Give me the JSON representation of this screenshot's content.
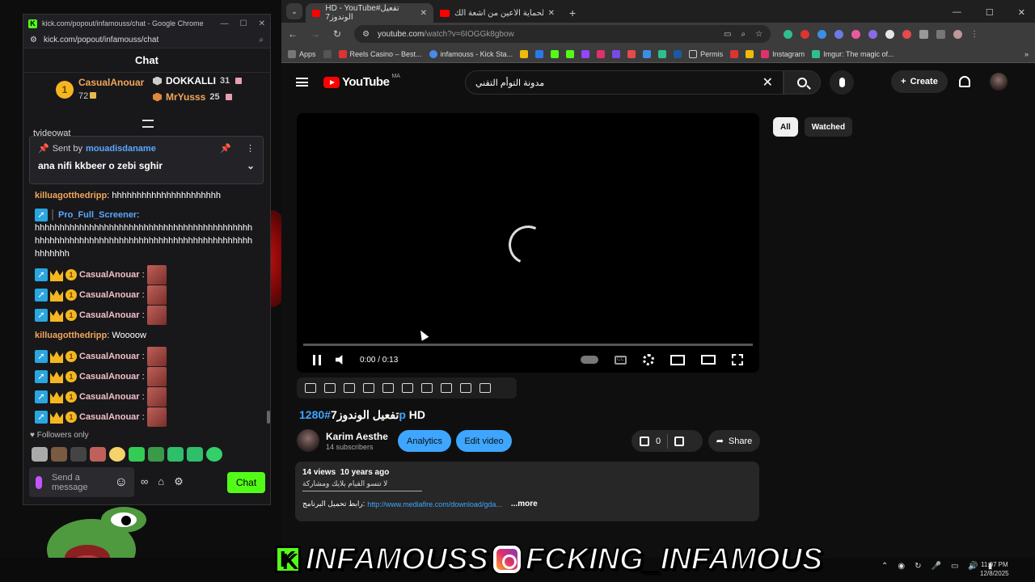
{
  "kick_window": {
    "title": "kick.com/popout/infamouss/chat - Google Chrome",
    "address": "kick.com/popout/infamouss/chat",
    "chat_title": "Chat",
    "leaderboard": [
      {
        "rank": "1",
        "name": "CasualAnouar",
        "count": "72"
      },
      {
        "rank": "",
        "name": "DOKKALLI",
        "count": "31"
      },
      {
        "rank": "3",
        "name": "MrYusss",
        "count": "25"
      }
    ],
    "cut_text": "tvideowat",
    "pinned": {
      "sent_by_label": "Sent by",
      "sender": "mouadisdaname",
      "message": "ana nifi kkbeer o zebi sghir"
    },
    "messages": [
      {
        "user": "killuagotthedripp",
        "text": "hhhhhhhhhhhhhhhhhhhhhh"
      },
      {
        "user": "Pro_Full_Screener",
        "text": "hhhhhhhhhhhhhhhhhhhhhhhhhhhhhhhhhhhhhhhhhhhhhhhhhhhhhhhhhhhhhhhhhhhhhhhhhhhhhhhhhhhhhhhhhhhhhhh"
      },
      {
        "user": "CasualAnouar"
      },
      {
        "user": "CasualAnouar"
      },
      {
        "user": "CasualAnouar"
      },
      {
        "user": "killuagotthedripp",
        "text": "Woooow"
      },
      {
        "user": "CasualAnouar"
      },
      {
        "user": "CasualAnouar"
      },
      {
        "user": "CasualAnouar"
      },
      {
        "user": "CasualAnouar"
      }
    ],
    "followers_only": "Followers only",
    "input_placeholder": "Send a message",
    "chat_button": "Chat"
  },
  "chrome": {
    "tabs": [
      {
        "label": "HD - YouTube#تفعيل الوندوز7",
        "active": true
      },
      {
        "label": "برنامج لحماية الأعين من أشعة الك",
        "active": false
      }
    ],
    "url_host": "youtube.com",
    "url_path": "/watch?v=6IOGGk8gbow",
    "bookmarks": [
      "Apps",
      "Reels Casino – Best...",
      "infamouss - Kick Sta...",
      "Permis",
      "Instagram",
      "Imgur: The magic of..."
    ]
  },
  "youtube": {
    "logo": "YouTube",
    "country": "MA",
    "search_query": "مدونة التوأم التقني",
    "create_label": "Create",
    "chips": [
      "All",
      "Watched"
    ],
    "time": "0:00 / 0:13",
    "title_prefix": "تفعيل الوندوز7",
    "title_hash": "#1280p",
    "title_suffix": " HD",
    "channel_name": "Karim Aesthe",
    "subscribers": "14 subscribers",
    "analytics_label": "Analytics",
    "edit_label": "Edit video",
    "likes": "0",
    "share_label": "Share",
    "views": "14 views",
    "age": "10 years ago",
    "desc_line1": "لا تنسو القيام بلايك ومشاركة",
    "desc_link_prefix": "رابط تحميل البرنامج: ",
    "desc_link": "http://www.mediafire.com/download/gda...",
    "more_label": "...more"
  },
  "taskbar": {
    "time": "11:07 PM",
    "date": "12/8/2025"
  },
  "overlay": {
    "k_letter": "K",
    "kick_name": "INFAMOUSS",
    "ig_name": "FCKING_INFAMOUS"
  },
  "colors": {
    "kick_green": "#53fc18",
    "yt_red": "#ff0000",
    "yt_blue": "#3ea6ff",
    "username_orange": "#f2a65a"
  }
}
